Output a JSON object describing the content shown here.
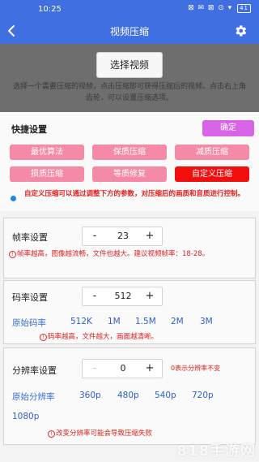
{
  "statusbar": {
    "time": "10:25",
    "icons": "⊠ ✉ ⊠ ⊙ ▾",
    "battery": "41"
  },
  "titlebar": {
    "title": "视频压缩",
    "back_icon": "back-arrow-icon",
    "settings_icon": "gear-icon"
  },
  "select": {
    "button_label": "选择视频",
    "description": "选择一个需要压缩的视频，点击压缩即可获得压缩后的视频。点击右上角齿轮，可以设置压缩选项。"
  },
  "quick": {
    "title": "快捷设置",
    "confirm_label": "确定",
    "presets": [
      {
        "label": "最优算法"
      },
      {
        "label": "保质压缩"
      },
      {
        "label": "减质压缩"
      },
      {
        "label": "损质压缩"
      },
      {
        "label": "等质修复"
      },
      {
        "label": "自定义压缩"
      }
    ],
    "note": "自定义压缩可以通过调整下方的参数，对压缩后的画质和音质进行控制。"
  },
  "framerate": {
    "label": "帧率设置",
    "minus": "-",
    "value": "23",
    "plus": "+",
    "warning": "帧率越高，图像越流畅，文件也越大。建议视频帧率：18-28。"
  },
  "bitrate": {
    "label": "码率设置",
    "minus": "-",
    "value": "512",
    "plus": "+",
    "original_label": "原始码率",
    "options": [
      "512K",
      "1M",
      "1.5M",
      "2M",
      "3M"
    ],
    "warning": "码率越高，文件越大，画面越清晰。"
  },
  "resolution": {
    "label": "分辨率设置",
    "minus": "-",
    "value": "0",
    "plus": "+",
    "zero_note": "0表示分辨率不变",
    "original_label": "原始分辨率",
    "options": [
      "360p",
      "480p",
      "540p",
      "720p",
      "1080p"
    ],
    "warning": "改变分辨率可能会导致压缩失败"
  },
  "watermark": "818手游网",
  "colors": {
    "accent": "#3f6fe0",
    "preset": "#f48aa6",
    "preset_active": "#f30e0e",
    "confirm": "#d765e6",
    "warning": "#e02121"
  }
}
